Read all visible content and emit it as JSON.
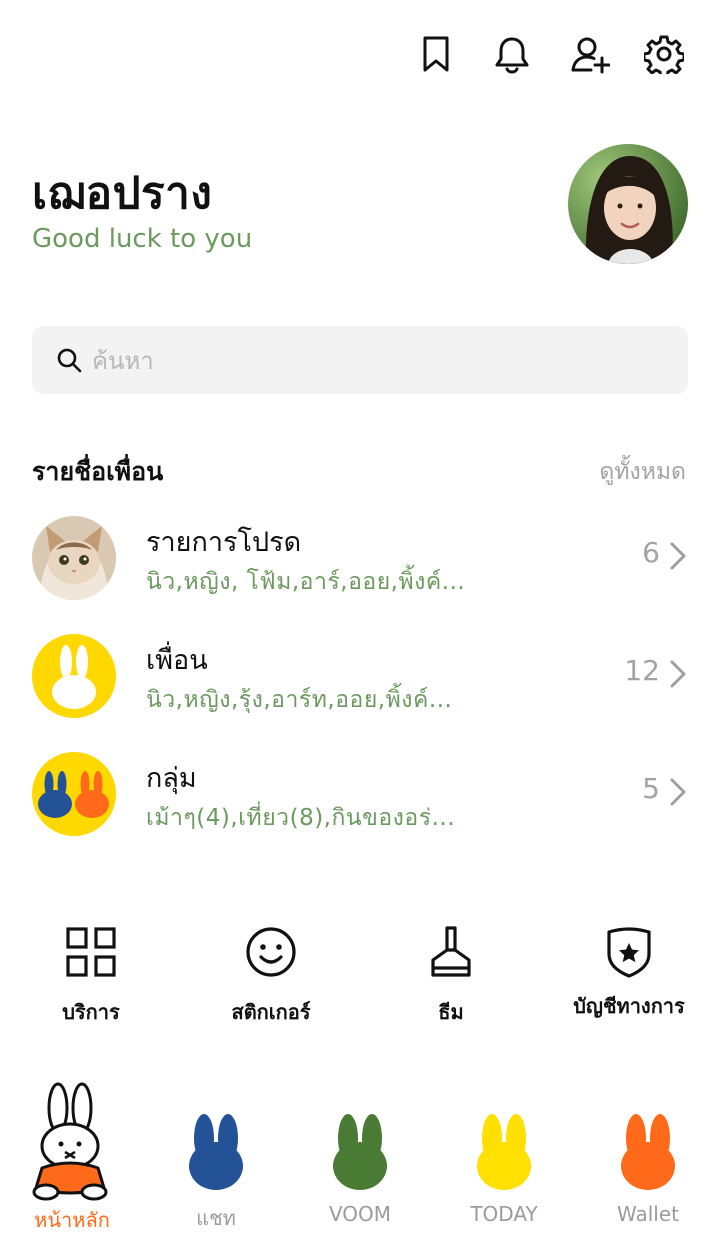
{
  "header": {
    "icons": [
      "bookmark-icon",
      "bell-icon",
      "add-friend-icon",
      "settings-icon"
    ]
  },
  "profile": {
    "name": "เฌอปราง",
    "status": "Good luck to you"
  },
  "search": {
    "placeholder": "ค้นหา"
  },
  "friends": {
    "title": "รายชื่อเพื่อน",
    "see_all": "ดูทั้งหมด",
    "rows": [
      {
        "title": "รายการโปรด",
        "subtitle": "นิว,หญิง, โฟ้ม,อาร์,ออย,พิ้งค์...",
        "count": "6"
      },
      {
        "title": "เพื่อน",
        "subtitle": "นิว,หญิง,รุ้ง,อาร์ท,ออย,พิ้งค์...",
        "count": "12"
      },
      {
        "title": "กลุ่ม",
        "subtitle": "เม้าๆ(4),เที่ยว(8),กินของอร่...",
        "count": "5"
      }
    ]
  },
  "services": {
    "items": [
      {
        "label": "บริการ",
        "icon": "grid-icon"
      },
      {
        "label": "สติกเกอร์",
        "icon": "smiley-icon"
      },
      {
        "label": "ธีม",
        "icon": "brush-icon"
      },
      {
        "label": "บัญชีทางการ",
        "icon": "official-account-icon"
      }
    ]
  },
  "tabbar": {
    "tabs": [
      {
        "label": "หน้าหลัก",
        "active": true
      },
      {
        "label": "แชท"
      },
      {
        "label": "VOOM"
      },
      {
        "label": "TODAY"
      },
      {
        "label": "Wallet"
      }
    ],
    "colors": {
      "active_label": "#ff6a1a",
      "chat": "#245296",
      "voom": "#4a7b34",
      "today": "#ffe000",
      "wallet": "#ff6a1a"
    }
  },
  "colors": {
    "status_green": "#6b9a5f",
    "muted_gray": "#a3a3a3",
    "search_bg": "#f3f3f3",
    "yellow_badge": "#ffd800"
  }
}
